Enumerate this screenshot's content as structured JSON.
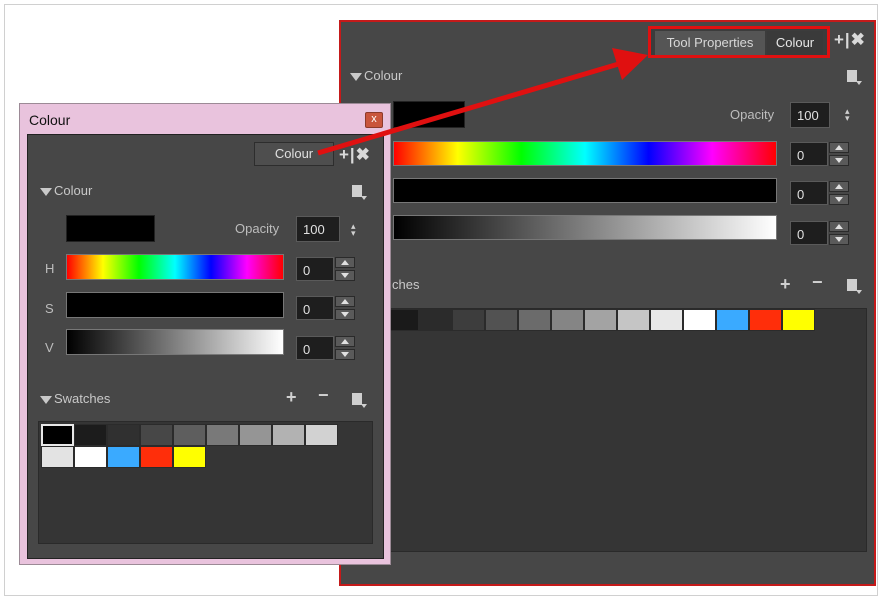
{
  "docked": {
    "tabs": [
      "Tool Properties",
      "Colour"
    ],
    "header_icons": "+|✖",
    "colour_section": "Colour",
    "opacity_label": "Opacity",
    "opacity_value": "100",
    "h_value": "0",
    "s_value": "0",
    "v_value": "0",
    "swatches_label": "ches",
    "plus": "+",
    "minus": "−"
  },
  "floating": {
    "title": "Colour",
    "close": "x",
    "colour_button": "Colour",
    "header_icons": "+|✖",
    "colour_section": "Colour",
    "opacity_label": "Opacity",
    "opacity_value": "100",
    "h_label": "H",
    "s_label": "S",
    "v_label": "V",
    "h_value": "0",
    "s_value": "0",
    "v_value": "0",
    "swatches_label": "Swatches",
    "plus": "+",
    "minus": "−"
  },
  "swatch_colors": {
    "docked_row": [
      "#1a1a1a",
      "#2b2b2b",
      "#3d3d3d",
      "#525252",
      "#6b6b6b",
      "#858585",
      "#a3a3a3",
      "#c5c5c5",
      "#e8e8e8",
      "#ffffff",
      "#3aaaff",
      "#ff2e0a",
      "#ffff00"
    ],
    "floating_row1": [
      "#000000",
      "#1c1c1c",
      "#303030",
      "#474747",
      "#5e5e5e",
      "#797979",
      "#959595",
      "#b2b2b2",
      "#d2d2d2"
    ],
    "floating_row2": [
      "#e3e3e3",
      "#ffffff",
      "#3aaaff",
      "#ff2e0a",
      "#ffff00"
    ]
  },
  "annotation_color": "#e01010"
}
